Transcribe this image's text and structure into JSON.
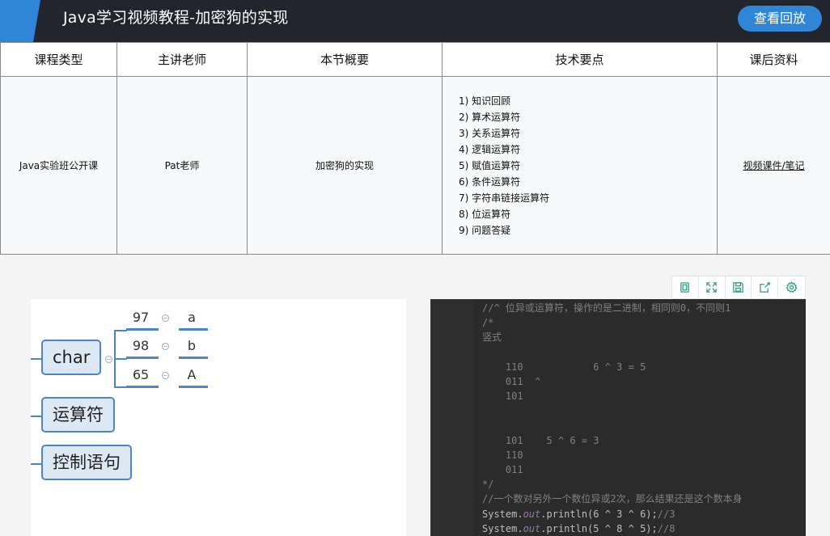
{
  "header": {
    "title": "Java学习视频教程-加密狗的实现",
    "replay_button": "查看回放",
    "accent_color": "#2f86d9",
    "background_color": "#23252e"
  },
  "course_table": {
    "headers": [
      "课程类型",
      "主讲老师",
      "本节概要",
      "技术要点",
      "课后资料"
    ],
    "course_type": "Java实验班公开课",
    "teacher": "Pat老师",
    "summary": "加密狗的实现",
    "tech_points": [
      "1) 知识回顾",
      "2) 算术运算符",
      "3) 关系运算符",
      "4) 逻辑运算符",
      "5) 赋值运算符",
      "6) 条件运算符",
      "7) 字符串链接运算符",
      "8) 位运算符",
      "9) 问题答疑"
    ],
    "materials_link": "视频课件/笔记"
  },
  "toolbar": {
    "icons": [
      "copy-icon",
      "fullscreen-icon",
      "save-icon",
      "share-icon",
      "settings-icon"
    ],
    "icon_color": "#2aa37a"
  },
  "mindmap": {
    "char_node": "char",
    "char_children": [
      {
        "code": "97",
        "char": "a"
      },
      {
        "code": "98",
        "char": "b"
      },
      {
        "code": "65",
        "char": "A"
      }
    ],
    "operator_node": "运算符",
    "control_node": "控制语句",
    "node_color": "#4b86c9"
  },
  "code_lines": [
    {
      "t": "//^ 位异或运算符，操作的是二进制，相同则0，不同则1",
      "c": "comment"
    },
    {
      "t": "/*",
      "c": "comment"
    },
    {
      "t": "竖式",
      "c": "comment"
    },
    {
      "t": "",
      "c": "comment"
    },
    {
      "t": "    110            6 ^ 3 = 5",
      "c": "comment"
    },
    {
      "t": "    011  ^",
      "c": "comment"
    },
    {
      "t": "    101",
      "c": "comment"
    },
    {
      "t": "",
      "c": "comment"
    },
    {
      "t": "",
      "c": "comment"
    },
    {
      "t": "    101    5 ^ 6 = 3",
      "c": "comment"
    },
    {
      "t": "    110",
      "c": "comment"
    },
    {
      "t": "    011",
      "c": "comment"
    },
    {
      "t": "*/",
      "c": "comment"
    },
    {
      "t": "//一个数对另外一个数位异或2次，那么结果还是这个数本身",
      "c": "comment"
    },
    {
      "t": "System.|out|.println(6 ^ 3 ^ 6);|//3",
      "c": "code"
    },
    {
      "t": "System.|out|.println(5 ^ 8 ^ 5);|//8",
      "c": "code"
    }
  ]
}
